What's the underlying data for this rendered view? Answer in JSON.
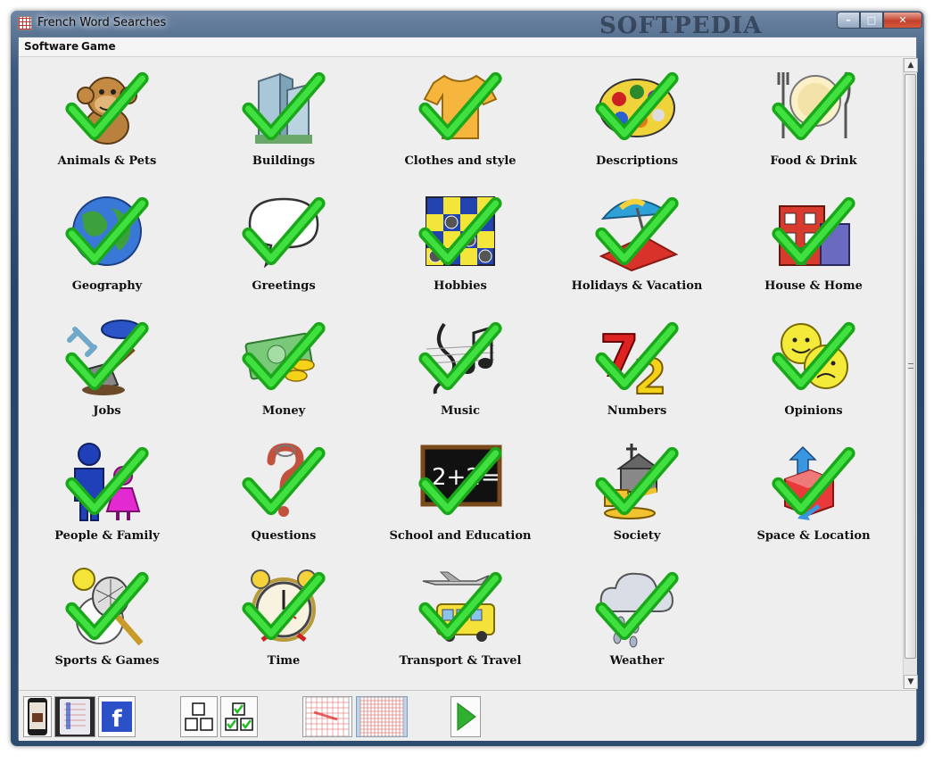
{
  "window": {
    "title": "French Word Searches",
    "watermark": "SOFTPEDIA",
    "controls": {
      "minimize": "–",
      "maximize": "□",
      "close": "✕"
    }
  },
  "menu": {
    "items": [
      "Software",
      "Game"
    ]
  },
  "categories": [
    {
      "label": "Animals & Pets",
      "icon": "monkey-icon",
      "completed": true
    },
    {
      "label": "Buildings",
      "icon": "buildings-icon",
      "completed": true
    },
    {
      "label": "Clothes and style",
      "icon": "tshirt-icon",
      "completed": true
    },
    {
      "label": "Descriptions",
      "icon": "paint-palette-icon",
      "completed": true
    },
    {
      "label": "Food & Drink",
      "icon": "plate-cutlery-icon",
      "completed": true
    },
    {
      "label": "Geography",
      "icon": "globe-icon",
      "completed": true
    },
    {
      "label": "Greetings",
      "icon": "speech-bubble-icon",
      "completed": true
    },
    {
      "label": "Hobbies",
      "icon": "checkerboard-icon",
      "completed": true
    },
    {
      "label": "Holidays & Vacation",
      "icon": "beach-umbrella-icon",
      "completed": true
    },
    {
      "label": "House & Home",
      "icon": "house-icon",
      "completed": true
    },
    {
      "label": "Jobs",
      "icon": "tools-icon",
      "completed": true
    },
    {
      "label": "Money",
      "icon": "money-icon",
      "completed": true
    },
    {
      "label": "Music",
      "icon": "music-notes-icon",
      "completed": true
    },
    {
      "label": "Numbers",
      "icon": "numbers-icon",
      "completed": true
    },
    {
      "label": "Opinions",
      "icon": "smiley-faces-icon",
      "completed": true
    },
    {
      "label": "People & Family",
      "icon": "people-icon",
      "completed": true
    },
    {
      "label": "Questions",
      "icon": "question-mark-icon",
      "completed": true
    },
    {
      "label": "School and Education",
      "icon": "chalkboard-icon",
      "completed": true
    },
    {
      "label": "Society",
      "icon": "church-gavel-icon",
      "completed": true
    },
    {
      "label": "Space & Location",
      "icon": "cube-arrows-icon",
      "completed": true
    },
    {
      "label": "Sports & Games",
      "icon": "sports-balls-icon",
      "completed": true
    },
    {
      "label": "Time",
      "icon": "alarm-clock-icon",
      "completed": true
    },
    {
      "label": "Transport & Travel",
      "icon": "plane-bus-icon",
      "completed": true
    },
    {
      "label": "Weather",
      "icon": "rain-cloud-icon",
      "completed": true
    }
  ],
  "toolbar": {
    "buttons": [
      {
        "name": "phone-app-button",
        "icon": "phone-icon"
      },
      {
        "name": "tablet-app-button",
        "icon": "tablet-icon"
      },
      {
        "name": "facebook-button",
        "icon": "facebook-icon",
        "text": "f"
      },
      {
        "name": "show-all-button",
        "icon": "empty-boxes-icon"
      },
      {
        "name": "show-completed-button",
        "icon": "checked-boxes-icon"
      },
      {
        "name": "grid-style-1-button",
        "icon": "letter-grid-icon"
      },
      {
        "name": "grid-style-2-button",
        "icon": "letter-grid-selected-icon"
      },
      {
        "name": "play-button",
        "icon": "play-icon"
      }
    ]
  },
  "colors": {
    "check_green": "#2cc22c",
    "window_frame": "#2e4d70",
    "client_bg": "#eeeeee",
    "facebook_blue": "#2b50c8",
    "play_green": "#30b030"
  }
}
